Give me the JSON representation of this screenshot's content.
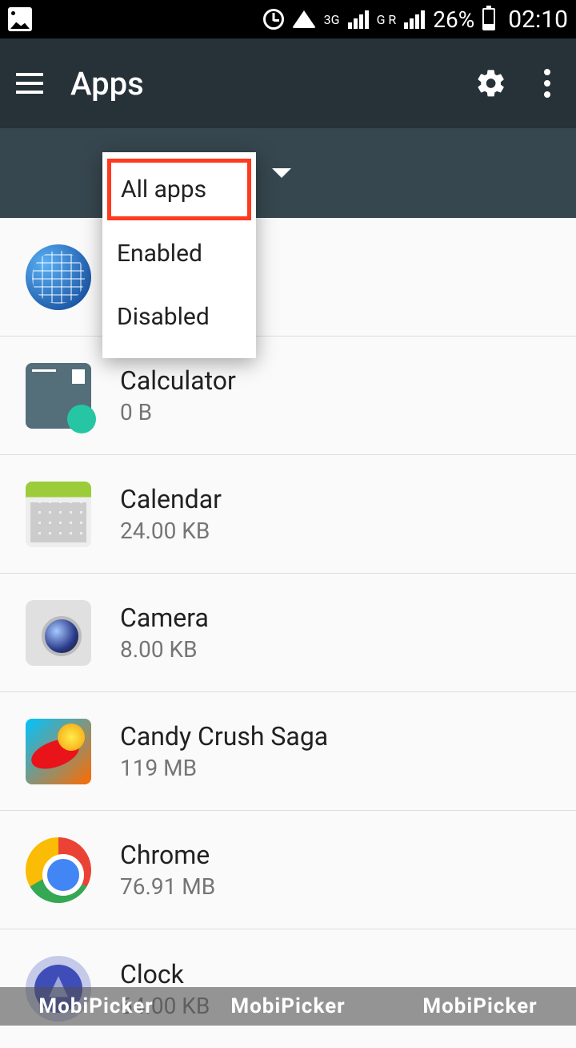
{
  "status": {
    "network1_label": "3G",
    "network2_label": "G R",
    "battery_pct": "26%",
    "time": "02:10"
  },
  "toolbar": {
    "title": "Apps"
  },
  "filter": {
    "selected": "All apps",
    "options": [
      "All apps",
      "Enabled",
      "Disabled"
    ]
  },
  "apps": [
    {
      "name": "Browser",
      "size": ""
    },
    {
      "name": "Calculator",
      "size": "0 B"
    },
    {
      "name": "Calendar",
      "size": "24.00 KB"
    },
    {
      "name": "Camera",
      "size": "8.00 KB"
    },
    {
      "name": "Candy Crush Saga",
      "size": "119 MB"
    },
    {
      "name": "Chrome",
      "size": "76.91 MB"
    },
    {
      "name": "Clock",
      "size": "64.00 KB"
    }
  ],
  "watermark": "MobiPicker"
}
